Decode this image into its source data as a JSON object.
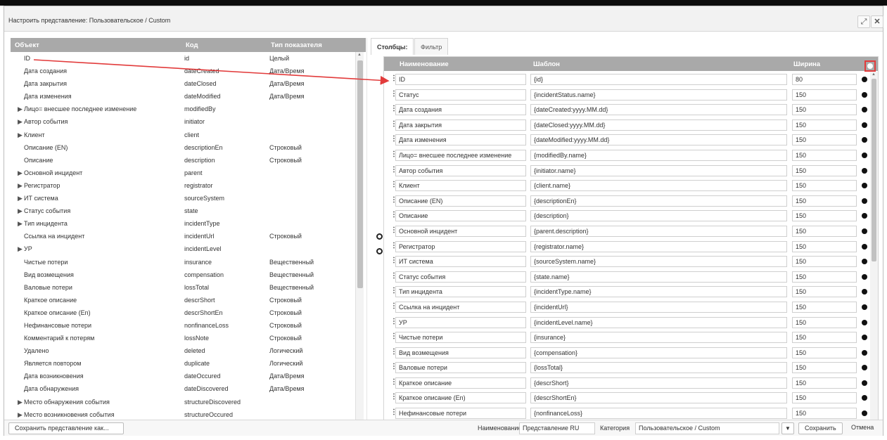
{
  "dialog": {
    "title": "Настроить представление: Пользовательское / Custom"
  },
  "left_table": {
    "headers": [
      "Объект",
      "Код",
      "Тип показателя"
    ],
    "rows": [
      {
        "name": "ID",
        "code": "id",
        "type": "Целый",
        "expandable": false
      },
      {
        "name": "Дата создания",
        "code": "dateCreated",
        "type": "Дата/Время",
        "expandable": false
      },
      {
        "name": "Дата закрытия",
        "code": "dateClosed",
        "type": "Дата/Время",
        "expandable": false
      },
      {
        "name": "Дата изменения",
        "code": "dateModified",
        "type": "Дата/Время",
        "expandable": false
      },
      {
        "name": "Лицо= внесшее последнее изменение",
        "code": "modifiedBy",
        "type": "",
        "expandable": true
      },
      {
        "name": "Автор события",
        "code": "initiator",
        "type": "",
        "expandable": true
      },
      {
        "name": "Клиент",
        "code": "client",
        "type": "",
        "expandable": true
      },
      {
        "name": "Описание (EN)",
        "code": "descriptionEn",
        "type": "Строковый",
        "expandable": false
      },
      {
        "name": "Описание",
        "code": "description",
        "type": "Строковый",
        "expandable": false
      },
      {
        "name": "Основной инцидент",
        "code": "parent",
        "type": "",
        "expandable": true
      },
      {
        "name": "Регистратор",
        "code": "registrator",
        "type": "",
        "expandable": true
      },
      {
        "name": "ИТ система",
        "code": "sourceSystem",
        "type": "",
        "expandable": true
      },
      {
        "name": "Статус события",
        "code": "state",
        "type": "",
        "expandable": true
      },
      {
        "name": "Тип инцидента",
        "code": "incidentType",
        "type": "",
        "expandable": true
      },
      {
        "name": "Ссылка на инцидент",
        "code": "incidentUrl",
        "type": "Строковый",
        "expandable": false
      },
      {
        "name": "УР",
        "code": "incidentLevel",
        "type": "",
        "expandable": true
      },
      {
        "name": "Чистые потери",
        "code": "insurance",
        "type": "Вещественный",
        "expandable": false
      },
      {
        "name": "Вид возмещения",
        "code": "compensation",
        "type": "Вещественный",
        "expandable": false
      },
      {
        "name": "Валовые потери",
        "code": "lossTotal",
        "type": "Вещественный",
        "expandable": false
      },
      {
        "name": "Краткое описание",
        "code": "descrShort",
        "type": "Строковый",
        "expandable": false
      },
      {
        "name": "Краткое описание (En)",
        "code": "descrShortEn",
        "type": "Строковый",
        "expandable": false
      },
      {
        "name": "Нефинансовые потери",
        "code": "nonfinanceLoss",
        "type": "Строковый",
        "expandable": false
      },
      {
        "name": "Комментарий к потерям",
        "code": "lossNote",
        "type": "Строковый",
        "expandable": false
      },
      {
        "name": "Удалено",
        "code": "deleted",
        "type": "Логический",
        "expandable": false
      },
      {
        "name": "Является повтором",
        "code": "duplicate",
        "type": "Логический",
        "expandable": false
      },
      {
        "name": "Дата возникновения",
        "code": "dateOccured",
        "type": "Дата/Время",
        "expandable": false
      },
      {
        "name": "Дата обнаружения",
        "code": "dateDiscovered",
        "type": "Дата/Время",
        "expandable": false
      },
      {
        "name": "Место обнаружения события",
        "code": "structureDiscovered",
        "type": "",
        "expandable": true
      },
      {
        "name": "Место возникновения события",
        "code": "structureOccured",
        "type": "",
        "expandable": true
      }
    ]
  },
  "tabs": {
    "columns": "Столбцы:",
    "filter": "Фильтр"
  },
  "columns_grid": {
    "headers": [
      "Наименование",
      "Шаблон",
      "Ширина"
    ],
    "rows": [
      {
        "name": "ID",
        "template": "{id}",
        "width": "80"
      },
      {
        "name": "Статус",
        "template": "{incidentStatus.name}",
        "width": "150"
      },
      {
        "name": "Дата создания",
        "template": "{dateCreated:yyyy.MM.dd}",
        "width": "150"
      },
      {
        "name": "Дата закрытия",
        "template": "{dateClosed:yyyy.MM.dd}",
        "width": "150"
      },
      {
        "name": "Дата изменения",
        "template": "{dateModified:yyyy.MM.dd}",
        "width": "150"
      },
      {
        "name": "Лицо= внесшее последнее изменение",
        "template": "{modifiedBy.name}",
        "width": "150"
      },
      {
        "name": "Автор события",
        "template": "{initiator.name}",
        "width": "150"
      },
      {
        "name": "Клиент",
        "template": "{client.name}",
        "width": "150"
      },
      {
        "name": "Описание (EN)",
        "template": "{descriptionEn}",
        "width": "150"
      },
      {
        "name": "Описание",
        "template": "{description}",
        "width": "150"
      },
      {
        "name": "Основной инцидент",
        "template": "{parent.description}",
        "width": "150"
      },
      {
        "name": "Регистратор",
        "template": "{registrator.name}",
        "width": "150"
      },
      {
        "name": "ИТ система",
        "template": "{sourceSystem.name}",
        "width": "150"
      },
      {
        "name": "Статус события",
        "template": "{state.name}",
        "width": "150"
      },
      {
        "name": "Тип инцидента",
        "template": "{incidentType.name}",
        "width": "150"
      },
      {
        "name": "Ссылка на инцидент",
        "template": "{incidentUrl}",
        "width": "150"
      },
      {
        "name": "УР",
        "template": "{incidentLevel.name}",
        "width": "150"
      },
      {
        "name": "Чистые потери",
        "template": "{insurance}",
        "width": "150"
      },
      {
        "name": "Вид возмещения",
        "template": "{compensation}",
        "width": "150"
      },
      {
        "name": "Валовые потери",
        "template": "{lossTotal}",
        "width": "150"
      },
      {
        "name": "Краткое описание",
        "template": "{descrShort}",
        "width": "150"
      },
      {
        "name": "Краткое описание (En)",
        "template": "{descrShortEn}",
        "width": "150"
      },
      {
        "name": "Нефинансовые потери",
        "template": "{nonfinanceLoss}",
        "width": "150"
      }
    ]
  },
  "footer": {
    "save_as": "Сохранить представление как...",
    "name_label": "Наименование",
    "name_value": "Представление RU",
    "category_label": "Категория",
    "category_value": "Пользовательское / Custom",
    "save": "Сохранить",
    "cancel": "Отмена"
  },
  "colors": {
    "header_bg": "#a9a9a9",
    "highlight": "#e23b3b"
  }
}
